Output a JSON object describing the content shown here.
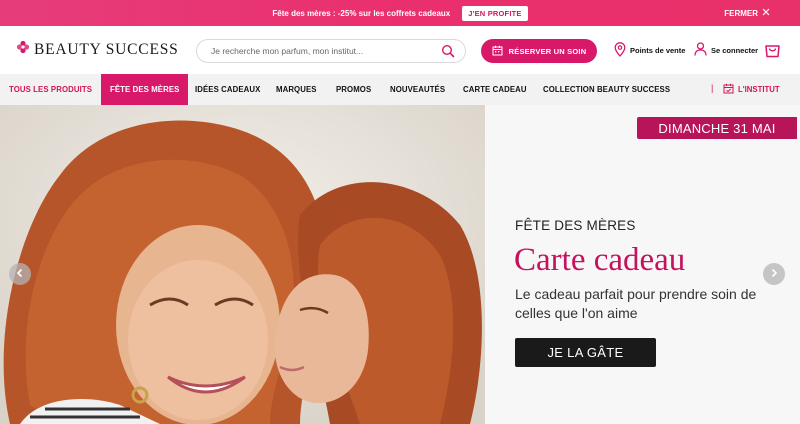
{
  "promo": {
    "text": "Fête des mères : -25% sur les coffrets cadeaux",
    "cta": "J'EN PROFITE",
    "close": "FERMER"
  },
  "header": {
    "logo": "BEAUTY SUCCESS",
    "search_placeholder": "Je recherche mon parfum, mon institut...",
    "reserve": "RÉSERVER UN SOIN",
    "points": "Points de vente",
    "login": "Se connecter"
  },
  "nav": {
    "items": [
      {
        "label": "TOUS LES PRODUITS"
      },
      {
        "label": "FÊTE DES MÈRES"
      },
      {
        "label": "IDÉES CADEAUX"
      },
      {
        "label": "MARQUES"
      },
      {
        "label": "PROMOS"
      },
      {
        "label": "NOUVEAUTÉS"
      },
      {
        "label": "CARTE CADEAU"
      },
      {
        "label": "COLLECTION BEAUTY SUCCESS"
      }
    ],
    "separator": "|",
    "institut": "L'INSTITUT"
  },
  "hero": {
    "date": "DIMANCHE 31 MAI",
    "kicker": "FÊTE DES MÈRES",
    "title": "Carte cadeau",
    "subtitle": "Le cadeau parfait pour prendre soin de celles que l'on aime",
    "cta": "JE LA GÂTE"
  },
  "colors": {
    "brand_pink": "#d8196a",
    "badge_pink": "#b8145a",
    "title_pink": "#c4125e",
    "cta_dark": "#1a1a1a"
  }
}
